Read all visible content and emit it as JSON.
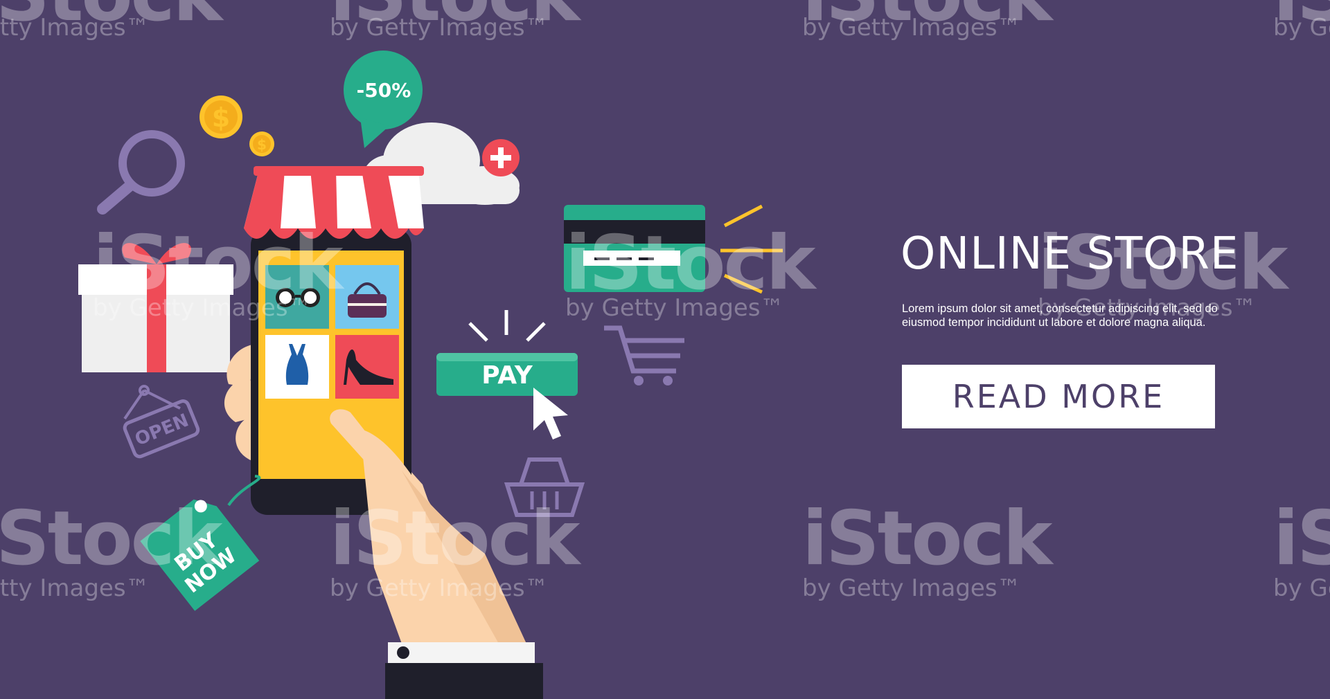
{
  "hero": {
    "title": "ONLINE STORE",
    "body": "Lorem ipsum dolor sit amet, consectetur adipiscing elit, sed do eiusmod tempor incididunt ut labore et dolore magna aliqua.",
    "button_label": "READ MORE"
  },
  "illustration": {
    "discount_badge": "-50%",
    "pay_button_label": "PAY",
    "tag_text_line1": "BUY",
    "tag_text_line2": "NOW",
    "open_sign_text": "OPEN",
    "coin_symbol": "$",
    "icons": [
      "dollar-coin-icon",
      "magnifier-icon",
      "speech-bubble-icon",
      "cloud-icon",
      "plus-icon",
      "awning-icon",
      "smartphone-icon",
      "sunglasses-icon",
      "handbag-icon",
      "swimsuit-icon",
      "high-heel-icon",
      "gift-box-icon",
      "open-sign-icon",
      "price-tag-icon",
      "hand-icon",
      "credit-card-icon",
      "shopping-cart-icon",
      "shopping-basket-icon",
      "cursor-icon"
    ]
  },
  "watermark": {
    "logo": "iStock",
    "sub": "by Getty Images™"
  },
  "colors": {
    "background": "#4d4069",
    "teal": "#27ad8b",
    "red": "#ef4b57",
    "yellow": "#fec32b",
    "white": "#ffffff",
    "skin": "#fbd3ab"
  }
}
